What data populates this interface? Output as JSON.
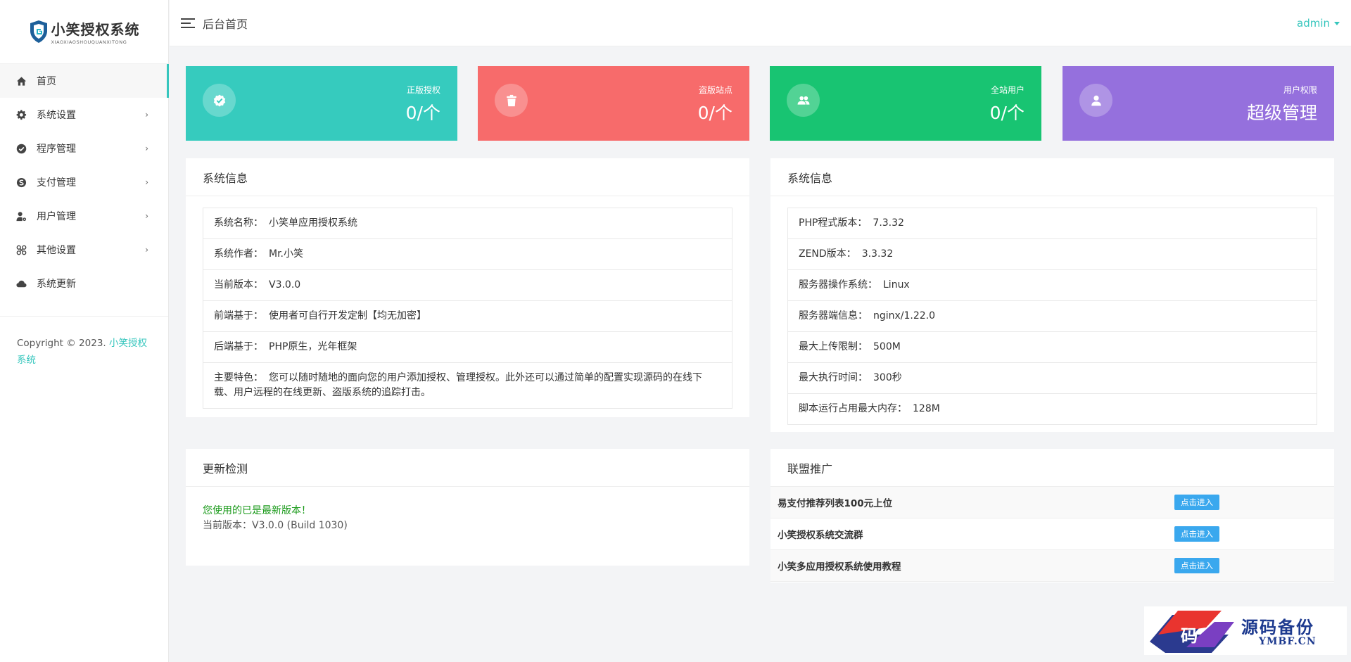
{
  "logo": {
    "title": "小笑授权系统",
    "subtitle": "XIAOXIAOSHOUQUANXITONG"
  },
  "sidebar": {
    "items": [
      {
        "label": "首页",
        "icon": "home-icon",
        "active": true
      },
      {
        "label": "系统设置",
        "icon": "gear-icon",
        "chevron": "›"
      },
      {
        "label": "程序管理",
        "icon": "verified-badge-icon",
        "chevron": "›"
      },
      {
        "label": "支付管理",
        "icon": "skype-icon",
        "chevron": "›"
      },
      {
        "label": "用户管理",
        "icon": "user-gear-icon",
        "chevron": "›"
      },
      {
        "label": "其他设置",
        "icon": "connections-icon",
        "chevron": "›"
      },
      {
        "label": "系统更新",
        "icon": "cloud-icon"
      }
    ]
  },
  "footer": {
    "copyright": "Copyright © 2023. ",
    "brand": "小笑授权系统"
  },
  "header": {
    "title": "后台首页",
    "user": "admin"
  },
  "stats": [
    {
      "label": "正版授权",
      "value": "0/个",
      "color": "#36cbbe",
      "icon": "check-badge-icon"
    },
    {
      "label": "盗版站点",
      "value": "0/个",
      "color": "#f76b6b",
      "icon": "trash-icon"
    },
    {
      "label": "全站用户",
      "value": "0/个",
      "color": "#18c472",
      "icon": "users-icon"
    },
    {
      "label": "用户权限",
      "value": "超级管理",
      "color": "#9570dd",
      "icon": "user-icon"
    }
  ],
  "sysinfo_left": {
    "title": "系统信息",
    "rows": [
      {
        "key": "系统名称：",
        "value": "小笑单应用授权系统"
      },
      {
        "key": "系统作者：",
        "value": "Mr.小笑"
      },
      {
        "key": "当前版本：",
        "value": "V3.0.0"
      },
      {
        "key": "前端基于：",
        "value": "使用者可自行开发定制【均无加密】"
      },
      {
        "key": "后端基于：",
        "value": "PHP原生，光年框架"
      },
      {
        "key": "主要特色：",
        "value": "您可以随时随地的面向您的用户添加授权、管理授权。此外还可以通过简单的配置实现源码的在线下载、用户远程的在线更新、盗版系统的追踪打击。"
      }
    ]
  },
  "sysinfo_right": {
    "title": "系统信息",
    "rows": [
      {
        "key": "PHP程式版本：",
        "value": "7.3.32"
      },
      {
        "key": "ZEND版本：",
        "value": "3.3.32"
      },
      {
        "key": "服务器操作系统：",
        "value": "Linux"
      },
      {
        "key": "服务器端信息：",
        "value": "nginx/1.22.0"
      },
      {
        "key": "最大上传限制：",
        "value": "500M"
      },
      {
        "key": "最大执行时间：",
        "value": "300秒"
      },
      {
        "key": "脚本运行占用最大内存：",
        "value": "128M"
      }
    ]
  },
  "update": {
    "title": "更新检测",
    "status": "您使用的已是最新版本！",
    "version": "当前版本：V3.0.0 (Build 1030)"
  },
  "alliance": {
    "title": "联盟推广",
    "rows": [
      {
        "name": "易支付推荐列表100元上位",
        "button": "点击进入"
      },
      {
        "name": "小笑授权系统交流群",
        "button": "点击进入"
      },
      {
        "name": "小笑多应用授权系统使用教程",
        "button": "点击进入"
      }
    ]
  },
  "watermark": {
    "title": "源码备份",
    "sub": "YMBF.CN"
  }
}
